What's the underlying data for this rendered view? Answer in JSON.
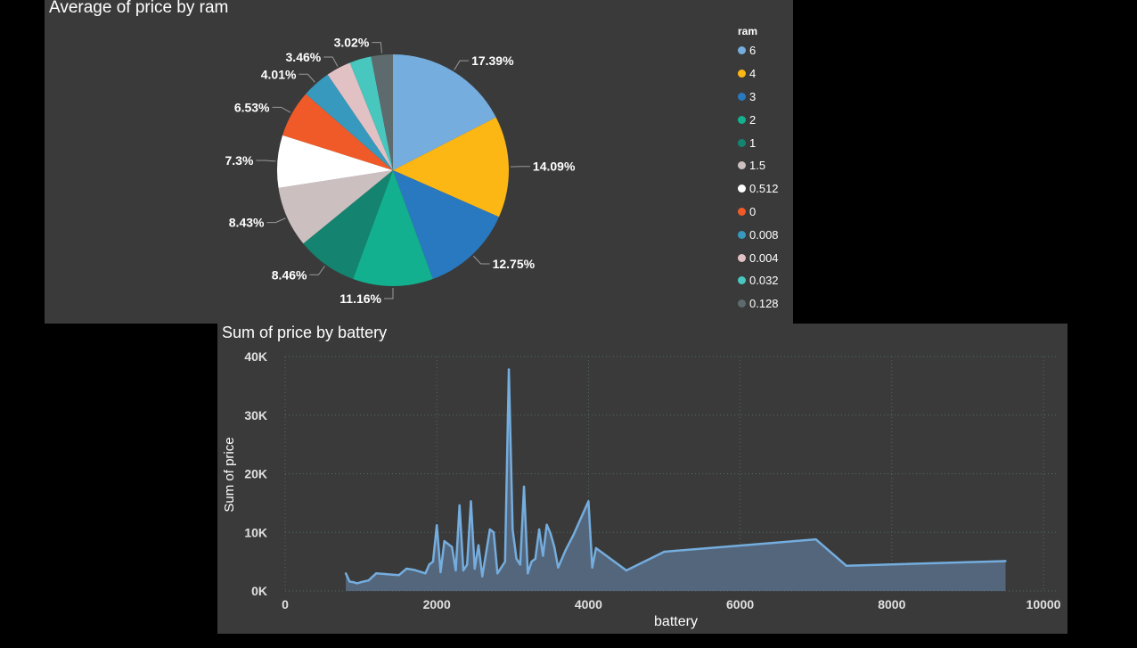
{
  "pie_panel": {
    "title": "Average of price by ram"
  },
  "line_panel": {
    "title": "Sum of price by battery"
  },
  "chart_data": [
    {
      "type": "pie",
      "title": "Average of price by ram",
      "legend_title": "ram",
      "legend_placement": "right",
      "slices": [
        {
          "label": "6",
          "value": 17.39,
          "display": "17.39%",
          "color": "#74ADDE"
        },
        {
          "label": "4",
          "value": 14.09,
          "display": "14.09%",
          "color": "#FDB714"
        },
        {
          "label": "3",
          "value": 12.75,
          "display": "12.75%",
          "color": "#2979C0"
        },
        {
          "label": "2",
          "value": 11.16,
          "display": "11.16%",
          "color": "#12B08F"
        },
        {
          "label": "1",
          "value": 8.46,
          "display": "8.46%",
          "color": "#148470"
        },
        {
          "label": "1.5",
          "value": 8.43,
          "display": "8.43%",
          "color": "#CCBFBF"
        },
        {
          "label": "0.512",
          "value": 7.3,
          "display": "7.3%",
          "color": "#FFFFFF"
        },
        {
          "label": "0",
          "value": 6.53,
          "display": "6.53%",
          "color": "#F05A28"
        },
        {
          "label": "0.008",
          "value": 4.01,
          "display": "4.01%",
          "color": "#3699BD"
        },
        {
          "label": "0.004",
          "value": 3.46,
          "display": "3.46%",
          "color": "#E2C1C4"
        },
        {
          "label": "0.032",
          "value": 3.02,
          "display": "",
          "color": "#48C7BF"
        },
        {
          "label": "0.128",
          "value": 3.02,
          "display": "3.02%",
          "color": "#5E6B6E"
        }
      ]
    },
    {
      "type": "area",
      "title": "Sum of price by battery",
      "xlabel": "battery",
      "ylabel": "Sum of price",
      "xlim": [
        0,
        10000
      ],
      "ylim": [
        0,
        40000
      ],
      "x_ticks": [
        0,
        2000,
        4000,
        6000,
        8000,
        10000
      ],
      "x_tick_labels": [
        "0",
        "2000",
        "4000",
        "6000",
        "8000",
        "10000"
      ],
      "y_ticks": [
        0,
        10000,
        20000,
        30000,
        40000
      ],
      "y_tick_labels": [
        "0K",
        "10K",
        "20K",
        "30K",
        "40K"
      ],
      "grid": true,
      "line_color": "#74ADDE",
      "fill_color": "#55687F",
      "x": [
        800,
        850,
        900,
        950,
        1000,
        1100,
        1200,
        1300,
        1400,
        1500,
        1600,
        1650,
        1700,
        1800,
        1850,
        1900,
        1950,
        2000,
        2050,
        2100,
        2150,
        2200,
        2250,
        2300,
        2350,
        2400,
        2450,
        2500,
        2550,
        2600,
        2650,
        2700,
        2750,
        2800,
        2850,
        2900,
        2950,
        3000,
        3050,
        3100,
        3150,
        3200,
        3250,
        3300,
        3350,
        3400,
        3450,
        3500,
        3550,
        3600,
        3700,
        3800,
        4000,
        4050,
        4100,
        4500,
        5000,
        7000,
        7400,
        9500
      ],
      "y": [
        3000,
        1600,
        1500,
        1300,
        1500,
        1800,
        3000,
        2900,
        2800,
        2700,
        3800,
        3700,
        3600,
        3200,
        3000,
        4500,
        5000,
        11200,
        3200,
        8500,
        8000,
        7500,
        3500,
        14600,
        3500,
        4500,
        15300,
        3800,
        7800,
        2500,
        6500,
        10500,
        10000,
        3000,
        4000,
        5000,
        37800,
        10500,
        5500,
        4500,
        17800,
        3000,
        5000,
        5500,
        10500,
        6000,
        11300,
        9800,
        7500,
        4000,
        7000,
        9500,
        15300,
        4000,
        7300,
        3500,
        6700,
        8800,
        4300,
        5100
      ]
    }
  ]
}
